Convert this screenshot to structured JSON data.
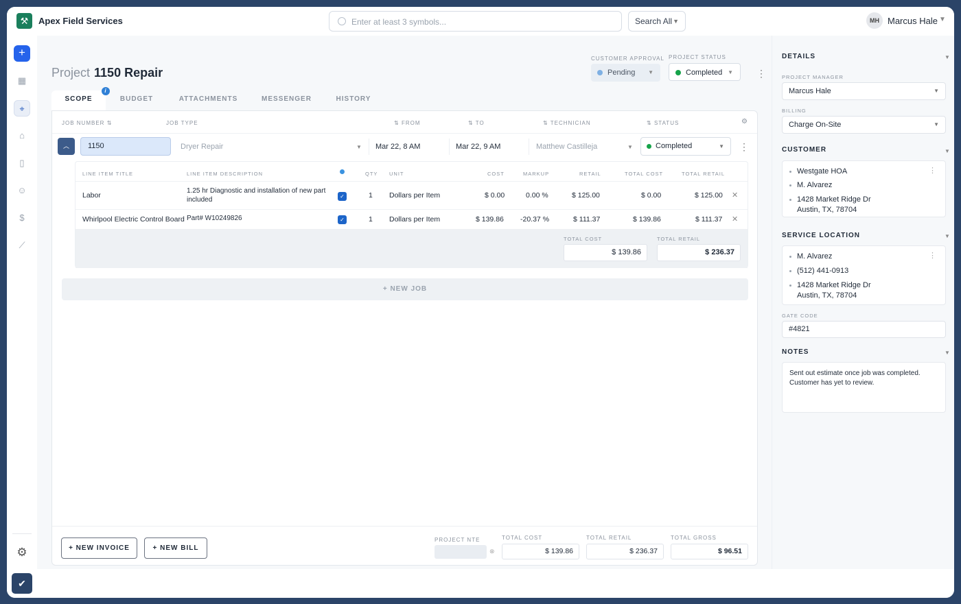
{
  "app": {
    "name": "Apex Field Services",
    "logo_icon": "tools-icon"
  },
  "search": {
    "placeholder": "Enter at least 3 symbols...",
    "scope": "Search All"
  },
  "user": {
    "initials": "MH",
    "name": "Marcus Hale"
  },
  "project": {
    "label": "Project",
    "title": "1150 Repair"
  },
  "customer_approval": {
    "label": "CUSTOMER APPROVAL",
    "value": "Pending",
    "color": "#7fb0e3"
  },
  "project_status": {
    "label": "PROJECT STATUS",
    "value": "Completed",
    "color": "#16a34a"
  },
  "tabs": [
    {
      "label": "SCOPE",
      "active": true
    },
    {
      "label": "BUDGET"
    },
    {
      "label": "ATTACHMENTS"
    },
    {
      "label": "MESSENGER"
    },
    {
      "label": "HISTORY"
    }
  ],
  "info_badge": "i",
  "job_table": {
    "headers": {
      "job_number": "JOB NUMBER",
      "job_type": "JOB TYPE",
      "from": "FROM",
      "to": "TO",
      "technician": "TECHNICIAN",
      "status": "STATUS"
    },
    "sort_glyph": "⇅",
    "row": {
      "job_number": "1150",
      "job_type": "Dryer Repair",
      "from": "Mar 22, 8 AM",
      "to": "Mar 22, 9 AM",
      "technician": "Matthew Castilleja",
      "status": "Completed"
    }
  },
  "line_items": {
    "headers": {
      "title": "LINE ITEM TITLE",
      "description": "LINE ITEM DESCRIPTION",
      "qty": "QTY",
      "unit": "UNIT",
      "cost": "COST",
      "markup": "MARKUP",
      "retail": "RETAIL",
      "total_cost": "TOTAL COST",
      "total_retail": "TOTAL RETAIL"
    },
    "rows": [
      {
        "title": "Labor",
        "description": "1.25 hr Diagnostic and installation of new part included",
        "checked": true,
        "qty": "1",
        "unit": "Dollars per Item",
        "cost": "$ 0.00",
        "markup": "0.00 %",
        "retail": "$ 125.00",
        "total_cost": "$ 0.00",
        "total_retail": "$ 125.00"
      },
      {
        "title": "Whirlpool Electric Control Board",
        "description": "Part# W10249826",
        "checked": true,
        "qty": "1",
        "unit": "Dollars per Item",
        "cost": "$ 139.86",
        "markup": "-20.37 %",
        "retail": "$ 111.37",
        "total_cost": "$ 139.86",
        "total_retail": "$ 111.37"
      }
    ],
    "totals": {
      "total_cost_label": "TOTAL COST",
      "total_cost": "$ 139.86",
      "total_retail_label": "TOTAL RETAIL",
      "total_retail": "$ 236.37"
    }
  },
  "new_job_label": "+ NEW JOB",
  "footer": {
    "new_invoice": "+ NEW INVOICE",
    "new_bill": "+ NEW BILL",
    "project_nte_label": "PROJECT NTE",
    "project_nte_value": "",
    "total_cost_label": "TOTAL COST",
    "total_cost": "$ 139.86",
    "total_retail_label": "TOTAL RETAIL",
    "total_retail": "$ 236.37",
    "total_gross_label": "TOTAL GROSS",
    "total_gross": "$ 96.51"
  },
  "details": {
    "title": "DETAILS",
    "project_manager_label": "PROJECT MANAGER",
    "project_manager": "Marcus Hale",
    "billing_label": "BILLING",
    "billing": "Charge On-Site"
  },
  "customer": {
    "title": "CUSTOMER",
    "items": [
      "Westgate HOA",
      "M. Alvarez",
      "1428 Market Ridge Dr",
      "Austin, TX, 78704"
    ]
  },
  "service_location": {
    "title": "SERVICE LOCATION",
    "items": [
      "M. Alvarez",
      "(512) 441-0913",
      "1428 Market Ridge Dr",
      "Austin, TX, 78704"
    ],
    "gate_code_label": "GATE CODE",
    "gate_code": "#4821"
  },
  "notes": {
    "title": "NOTES",
    "text": "Sent out estimate once job was completed. Customer has yet to review."
  },
  "nav_icons": [
    "add-icon",
    "dashboard-icon",
    "map-pin-icon",
    "store-icon",
    "document-icon",
    "users-icon",
    "dollar-icon",
    "chart-icon",
    "settings-icon",
    "brand-icon"
  ]
}
